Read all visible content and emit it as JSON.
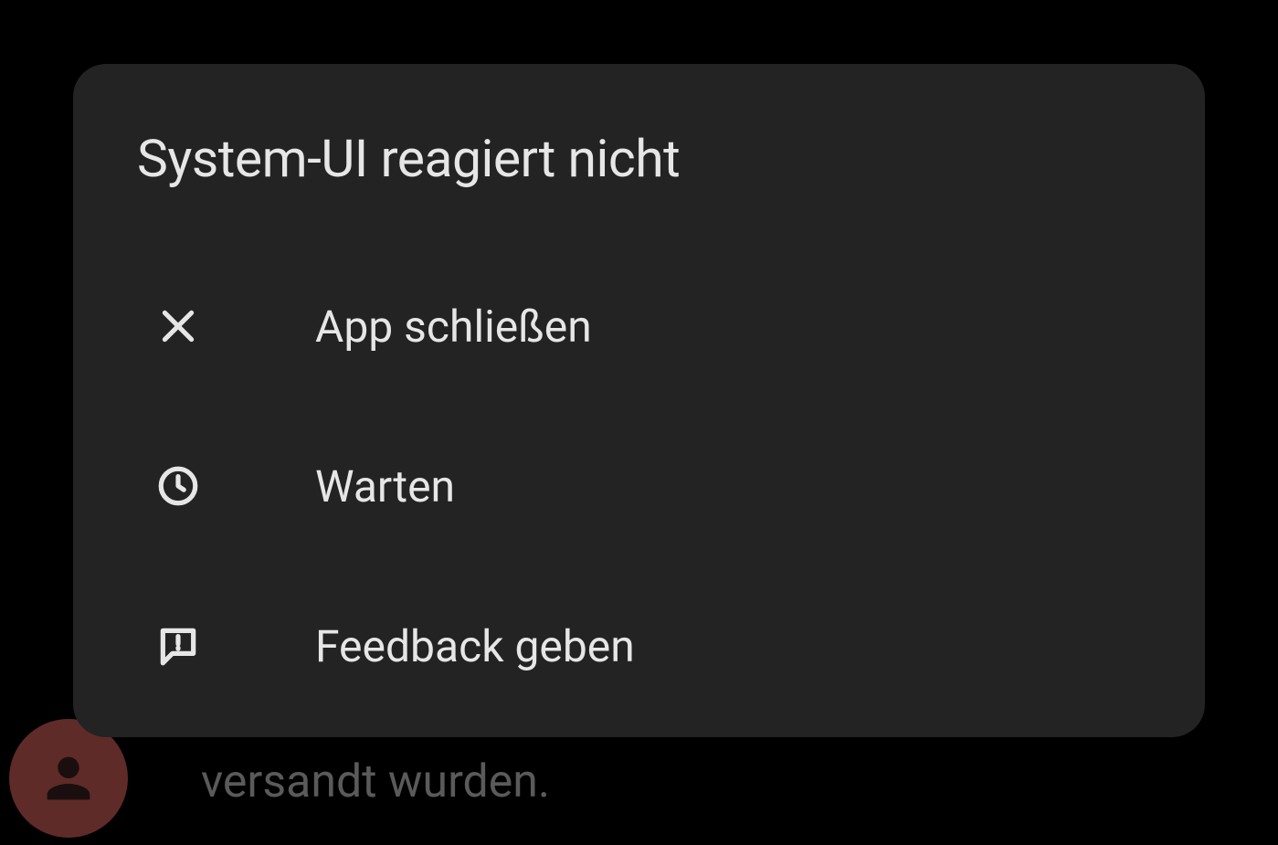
{
  "dialog": {
    "title": "System-UI reagiert nicht",
    "options": [
      {
        "label": "App schließen",
        "icon": "close"
      },
      {
        "label": "Warten",
        "icon": "clock"
      },
      {
        "label": "Feedback geben",
        "icon": "feedback"
      }
    ]
  },
  "background": {
    "partial_text": "versandt wurden."
  }
}
